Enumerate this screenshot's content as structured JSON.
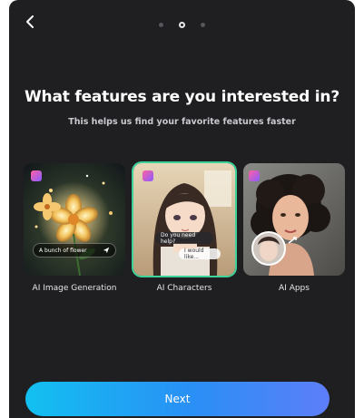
{
  "header": {
    "progress": {
      "total_steps": 3,
      "current_step": 2
    }
  },
  "title": "What features are you interested in?",
  "subtitle": "This helps us find your favorite features faster",
  "cards": [
    {
      "label": "AI Image Generation",
      "selected": false,
      "prompt_chip": "A bunch of flower"
    },
    {
      "label": "AI Characters",
      "selected": true,
      "chat_bubble_1": "Do you need help?",
      "chat_bubble_2": "I would like..."
    },
    {
      "label": "AI Apps",
      "selected": false
    }
  ],
  "next_button": {
    "label": "Next"
  },
  "colors": {
    "background": "#1f1f21",
    "selected_border": "#3bd39a",
    "button_gradient_start": "#12c0f0",
    "button_gradient_end": "#5d7ef8"
  }
}
